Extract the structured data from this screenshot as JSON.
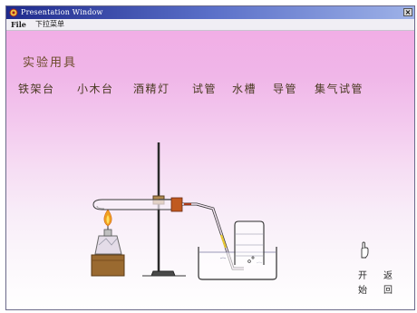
{
  "window": {
    "title": "Presentation Window",
    "close_glyph": "×",
    "icon": "app-icon"
  },
  "menu": {
    "items": [
      {
        "label": "File"
      },
      {
        "label": "下拉菜单"
      }
    ]
  },
  "main": {
    "heading": "实验用具",
    "tools": [
      {
        "label": "铁架台"
      },
      {
        "label": "小木台"
      },
      {
        "label": "酒精灯"
      },
      {
        "label": "试管"
      },
      {
        "label": "水槽"
      },
      {
        "label": "导管"
      },
      {
        "label": "集气试管"
      }
    ]
  },
  "controls": {
    "start_top": "开",
    "start_bottom": "始",
    "back_top": "返",
    "back_bottom": "回",
    "cursor_icon": "hand-pointer-icon"
  },
  "colors": {
    "title_bar": "#1e2a8c",
    "background_top": "#f1aee6",
    "heading_text": "#6a4a28",
    "flame": "#f0a020"
  }
}
